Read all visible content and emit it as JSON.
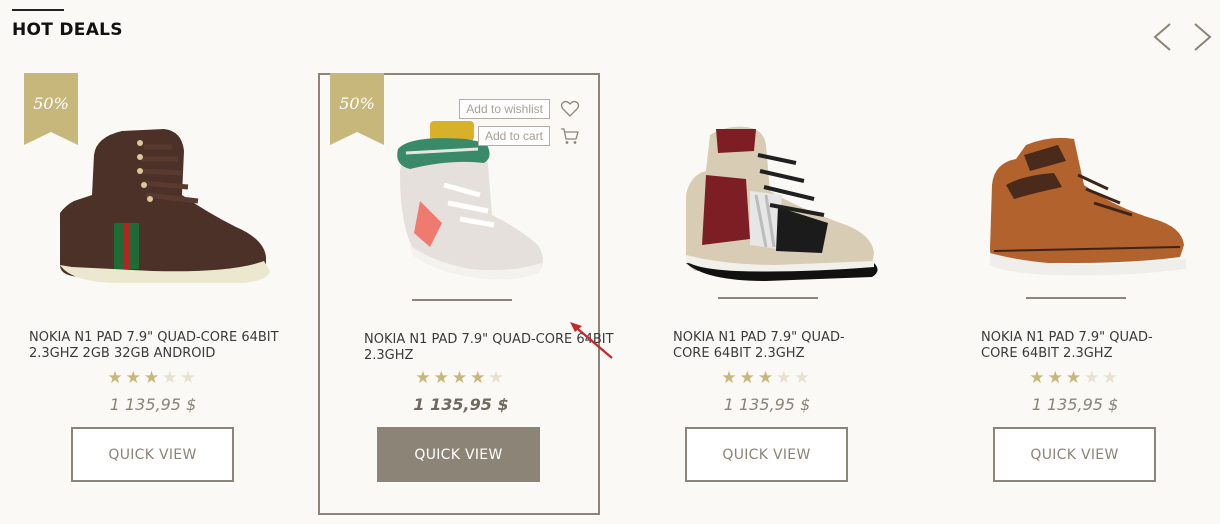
{
  "section": {
    "title": "HOT DEALS"
  },
  "nav": {
    "prev_icon": "chevron-left-icon",
    "next_icon": "chevron-right-icon"
  },
  "colors": {
    "accent": "#c8b77b",
    "muted": "#8c8577",
    "star_off": "#e8e1cc",
    "background": "#faf9f6"
  },
  "products": [
    {
      "badge": "50%",
      "name": "NOKIA N1 PAD 7.9\" QUAD-CORE 64BIT 2.3GHZ 2GB 32GB ANDROID",
      "rating": 3,
      "price": "1 135,95 $",
      "button": "QUICK VIEW"
    },
    {
      "badge": "50%",
      "name": "NOKIA N1 PAD 7.9\" QUAD-CORE 64BIT 2.3GHZ",
      "rating": 4,
      "price": "1 135,95 $",
      "button": "QUICK VIEW",
      "wishlist": "Add to wishlist",
      "cart": "Add to cart"
    },
    {
      "name": "NOKIA N1 PAD 7.9\" QUAD-CORE 64BIT 2.3GHZ",
      "rating": 3,
      "price": "1 135,95 $",
      "button": "QUICK VIEW"
    },
    {
      "name": "NOKIA N1 PAD 7.9\" QUAD-CORE 64BIT 2.3GHZ",
      "rating": 3,
      "price": "1 135,95 $",
      "button": "QUICK VIEW"
    }
  ]
}
